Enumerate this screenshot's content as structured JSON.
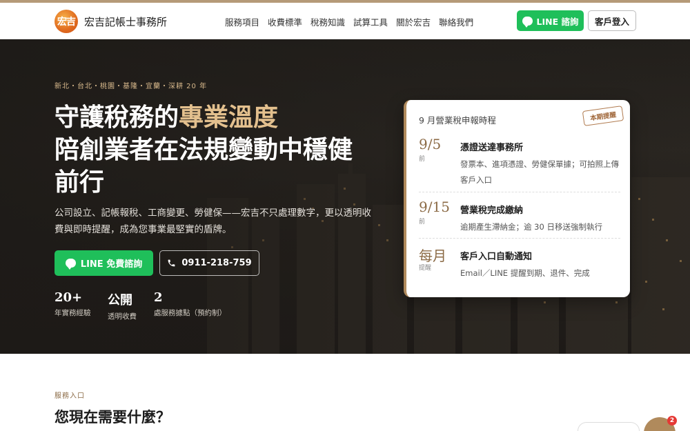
{
  "header": {
    "logo_text": "宏吉",
    "brand_name": "宏吉記帳士事務所",
    "nav": [
      "服務項目",
      "收費標準",
      "稅務知識",
      "試算工具",
      "關於宏吉",
      "聯絡我們"
    ],
    "line_button": "LINE 諮詢",
    "login_button": "客戶登入"
  },
  "hero": {
    "eyebrow": "新北・台北・桃園・基隆・宜蘭・深耕 20 年",
    "headline_1a": "守護稅務的",
    "headline_1b": "專業溫度",
    "headline_2": "陪創業者在法規變動中穩健",
    "headline_3": "前行",
    "description": "公司設立、記帳報稅、工商變更、勞健保——宏吉不只處理數字，更以透明收費與即時提醒，成為您事業最堅實的盾牌。",
    "cta_line": "LINE 免費諮詢",
    "cta_phone": "0911-218-759",
    "stats": [
      {
        "value": "20+",
        "label": "年實務經驗"
      },
      {
        "value": "公開",
        "label": "透明收費"
      },
      {
        "value": "2",
        "label": "處服務據點（預約制）"
      }
    ]
  },
  "card": {
    "title": "9 月營業稅申報時程",
    "stamp": "本期提醒",
    "items": [
      {
        "date": "9/5",
        "date_sub": "前",
        "title": "憑證送達事務所",
        "body": "發票本、進項憑證、勞健保單據；可拍照上傳客戶入口"
      },
      {
        "date": "9/15",
        "date_sub": "前",
        "title": "營業稅完成繳納",
        "body": "逾期產生滯納金；逾 30 日移送強制執行"
      },
      {
        "date": "每月",
        "date_sub": "提醒",
        "title": "客戶入口自動通知",
        "body": "Email／LINE 提醒到期、退件、完成"
      }
    ]
  },
  "services": {
    "eyebrow": "服務入口",
    "title": "您現在需要什麼？"
  },
  "chat": {
    "badge": "2"
  },
  "colors": {
    "accent": "#e3c08e",
    "line_green": "#1fbf5a",
    "brown": "#8b6a45"
  }
}
